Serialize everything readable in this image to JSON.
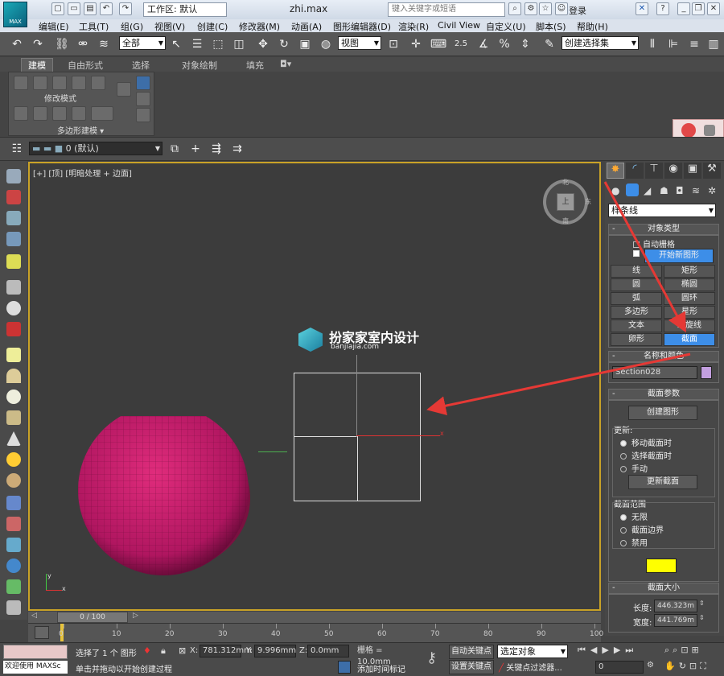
{
  "titlebar": {
    "logo_label": "MAX",
    "workspace": "工作区: 默认",
    "filename": "zhi.max",
    "search_placeholder": "键入关键字或短语",
    "login": "登录",
    "help": "?"
  },
  "menu": [
    "编辑(E)",
    "工具(T)",
    "组(G)",
    "视图(V)",
    "创建(C)",
    "修改器(M)",
    "动画(A)",
    "图形编辑器(D)",
    "渲染(R)",
    "Civil View",
    "自定义(U)",
    "脚本(S)",
    "帮助(H)"
  ],
  "toolbar": {
    "filter": "全部",
    "ref_coord": "视图",
    "snap_value": "2.5",
    "selection_set": "创建选择集"
  },
  "ribbon": {
    "tabs": [
      "建模",
      "自由形式",
      "选择",
      "对象绘制",
      "填充"
    ],
    "panel_label": "修改模式",
    "group_label": "多边形建模"
  },
  "layerbar": {
    "layer": "0 (默认)"
  },
  "viewport": {
    "label": "[+] [顶] [明暗处理 + 边面]",
    "watermark_title": "扮家家室内设计",
    "watermark_url": "banjiajia.com",
    "viewcube_top": "北",
    "viewcube_bottom": "南",
    "viewcube_right": "东",
    "viewcube_face": "上",
    "axis_x": "x",
    "axis_y": "y"
  },
  "command_panel": {
    "category": "样条线",
    "object_type": {
      "title": "对象类型",
      "autogrid": "自动栅格",
      "start_new_shape": "开始新图形",
      "buttons": [
        "线",
        "矩形",
        "圆",
        "椭圆",
        "弧",
        "圆环",
        "多边形",
        "星形",
        "文本",
        "螺旋线",
        "卵形",
        "截面"
      ],
      "active": "截面"
    },
    "name_color": {
      "title": "名称和颜色",
      "name": "Section028",
      "color": "#c39fe0"
    },
    "section_params": {
      "title": "截面参数",
      "create_shape": "创建图形",
      "update_label": "更新:",
      "update_options": [
        "移动截面时",
        "选择截面时",
        "手动"
      ],
      "update_selected": 0,
      "update_button": "更新截面",
      "range_label": "截面范围",
      "range_options": [
        "无限",
        "截面边界",
        "禁用"
      ],
      "range_selected": 0,
      "swatch_color": "#ffff00"
    },
    "section_size": {
      "title": "截面大小",
      "length_label": "长度:",
      "length": "446.323m",
      "width_label": "宽度:",
      "width": "441.769m"
    }
  },
  "timeline": {
    "frame": "0 / 100",
    "ticks": [
      "0",
      "10",
      "20",
      "30",
      "40",
      "50",
      "60",
      "70",
      "80",
      "90",
      "100"
    ]
  },
  "status": {
    "welcome": "欢迎使用 MAXSc",
    "selected": "选择了 1 个 图形",
    "prompt": "单击并拖动以开始创建过程",
    "x_label": "X:",
    "x": "781.312mm",
    "y_label": "Y:",
    "y": "9.996mm",
    "z_label": "Z:",
    "z": "0.0mm",
    "grid": "栅格 = 10.0mm",
    "add_time_tag": "添加时间标记",
    "auto_key": "自动关键点",
    "set_key": "设置关键点",
    "key_mode": "选定对象",
    "key_filters": "关键点过滤器...",
    "current_frame": "0"
  },
  "colors": {
    "sphere": "#c2185b",
    "active_button": "#3d8ee8",
    "viewport_border": "#c9a227",
    "arrow": "#e53935"
  }
}
